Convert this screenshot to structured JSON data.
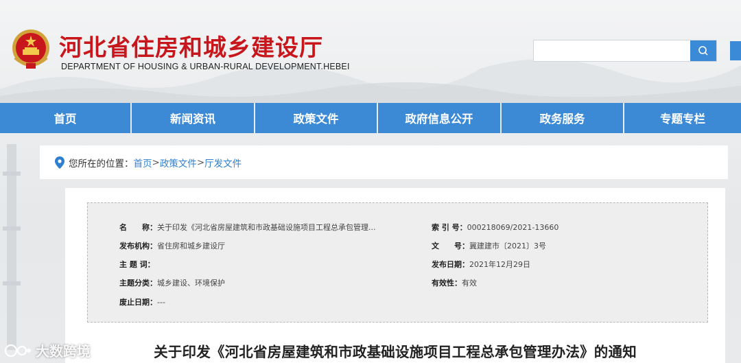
{
  "site": {
    "title": "河北省住房和城乡建设厅",
    "subtitle": "DEPARTMENT OF HOUSING & URBAN-RURAL DEVELOPMENT.HEBEI"
  },
  "search": {
    "placeholder": "",
    "value": ""
  },
  "nav": {
    "items": [
      {
        "label": "首页"
      },
      {
        "label": "新闻资讯"
      },
      {
        "label": "政策文件"
      },
      {
        "label": "政府信息公开"
      },
      {
        "label": "政务服务"
      },
      {
        "label": "专题专栏"
      }
    ]
  },
  "breadcrumb": {
    "label": "您所在的位置：",
    "items": [
      "首页",
      "政策文件",
      "厅发文件"
    ],
    "separator": ">"
  },
  "meta": {
    "name_key": "名　　称：",
    "name_value": "关于印发《河北省房屋建筑和市政基础设施项目工程总承包管理...",
    "index_key": "索 引 号：",
    "index_value": "000218069/2021-13660",
    "issuer_key": "发布机构：",
    "issuer_value": "省住房和城乡建设厅",
    "docno_key": "文　　号：",
    "docno_value": "冀建建市〔2021〕3号",
    "subject_key": "主 题 词：",
    "subject_value": "",
    "date_key": "发布日期：",
    "date_value": "2021年12月29日",
    "category_key": "主题分类：",
    "category_value": "城乡建设、环境保护",
    "validity_key": "有效性：",
    "validity_value": "有效",
    "expire_key": "废止日期：",
    "expire_value": "---"
  },
  "document": {
    "title": "关于印发《河北省房屋建筑和市政基础设施项目工程总承包管理办法》的通知"
  },
  "watermark": {
    "text": "大数跨境"
  },
  "colors": {
    "brand_red": "#c8161d",
    "nav_blue": "#3c8ad6",
    "link_blue": "#2f7fd0"
  },
  "icons": {
    "search": "search-icon",
    "location": "location-pin-icon",
    "emblem": "national-emblem-icon"
  }
}
